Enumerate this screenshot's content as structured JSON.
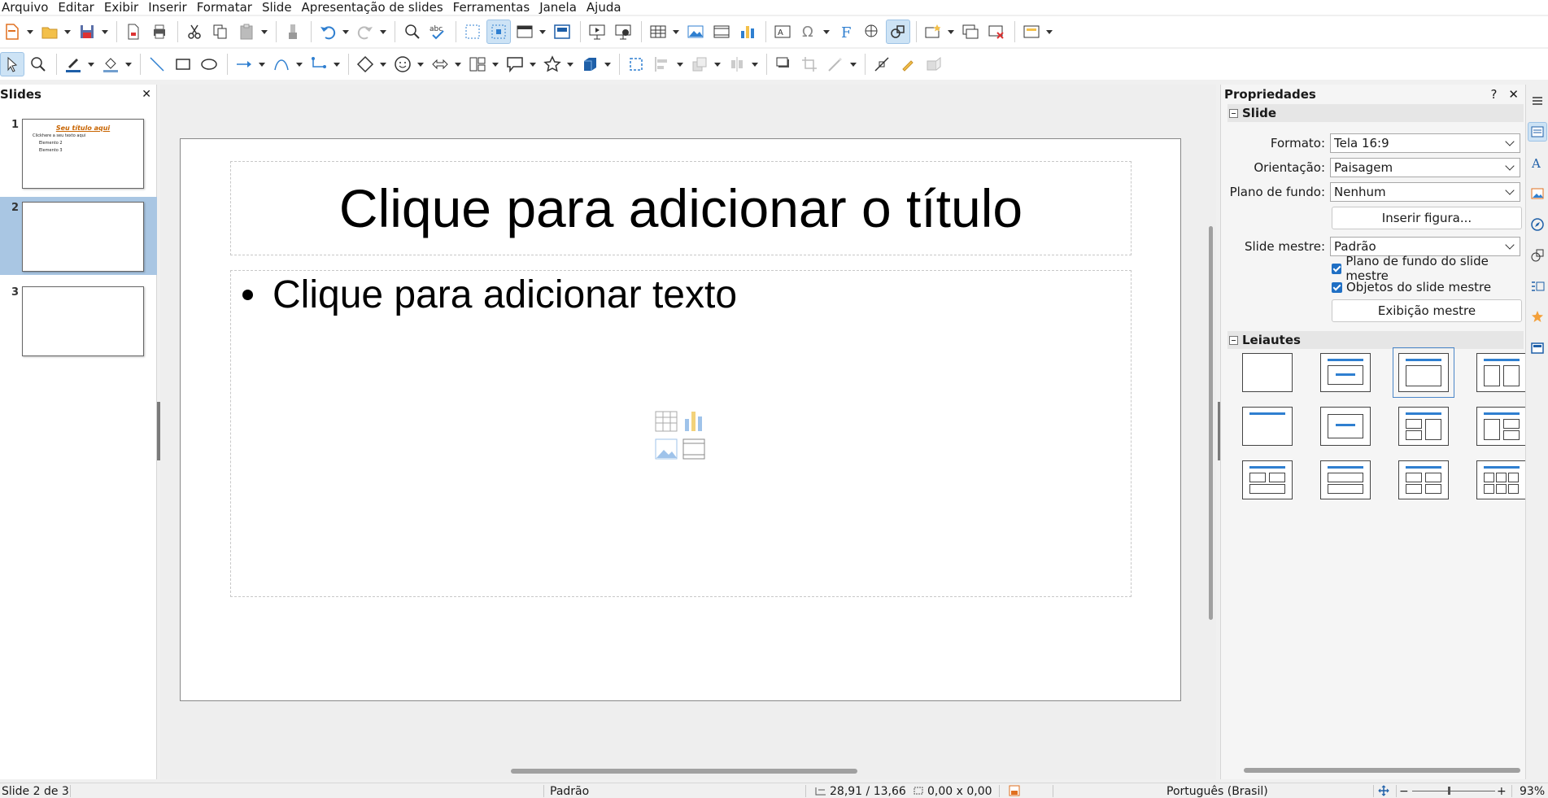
{
  "menu": [
    "Arquivo",
    "Editar",
    "Exibir",
    "Inserir",
    "Formatar",
    "Slide",
    "Apresentação de slides",
    "Ferramentas",
    "Janela",
    "Ajuda"
  ],
  "slides_pane": {
    "title": "Slides",
    "thumbs": [
      {
        "num": "1",
        "title": "Seu título aqui",
        "lines": [
          "Clickhere a seu texto aqui",
          "Elemento 2",
          "Elemento 3"
        ]
      },
      {
        "num": "2"
      },
      {
        "num": "3"
      }
    ]
  },
  "slide": {
    "title_placeholder": "Clique para adicionar o título",
    "body_placeholder": "Clique para adicionar texto"
  },
  "sidebar": {
    "title": "Propriedades",
    "help": "?",
    "close": "✕",
    "section_slide": "Slide",
    "formato_label": "Formato:",
    "formato_value": "Tela 16:9",
    "orientacao_label": "Orientação:",
    "orientacao_value": "Paisagem",
    "fundo_label": "Plano de fundo:",
    "fundo_value": "Nenhum",
    "inserir_figura": "Inserir figura...",
    "mestre_label": "Slide mestre:",
    "mestre_value": "Padrão",
    "chk_fundo": "Plano de fundo do slide mestre",
    "chk_objetos": "Objetos do slide mestre",
    "exibicao_mestre": "Exibição mestre",
    "section_layouts": "Leiautes"
  },
  "status": {
    "slide_pos": "Slide 2 de 3",
    "master": "Padrão",
    "position": "28,91 / 13,66",
    "size": "0,00 x 0,00",
    "language": "Português (Brasil)",
    "zoom": "93%"
  },
  "colors": {
    "accent": "#2f7fd0",
    "selection": "#a9c6e3",
    "title_thumb": "#c86400"
  }
}
